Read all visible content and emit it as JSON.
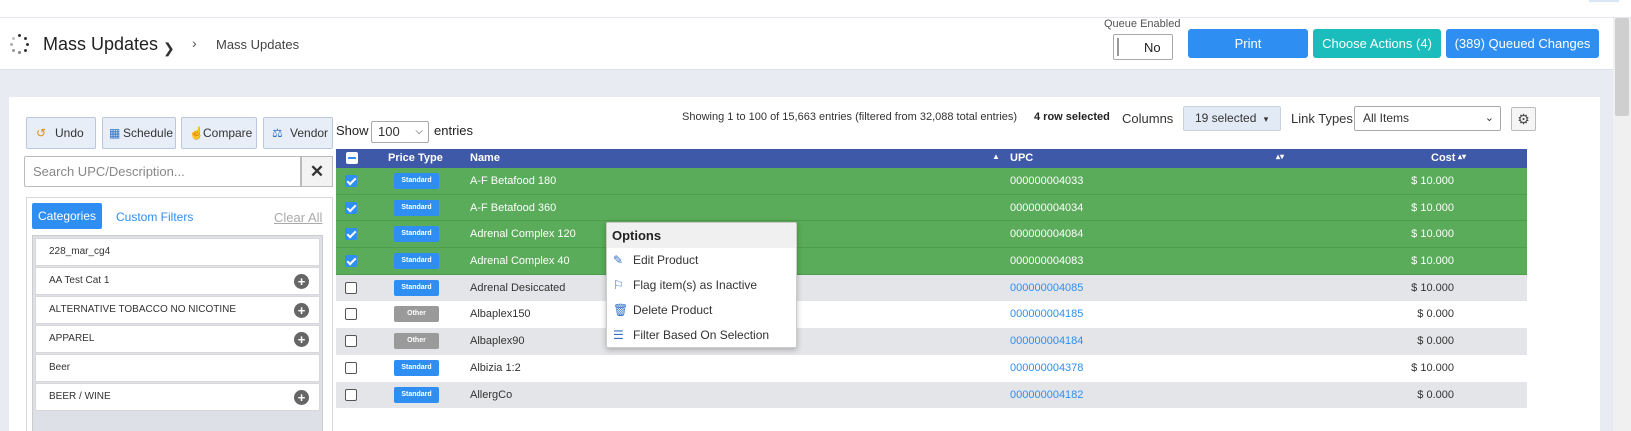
{
  "header": {
    "title": "Mass Updates",
    "breadcrumb": "Mass Updates",
    "queue_label": "Queue Enabled",
    "queue_value": "No",
    "print_label": "Print",
    "choose_actions_label": "Choose Actions (4)",
    "queued_changes_label": "(389) Queued Changes"
  },
  "left": {
    "undo_label": "Undo",
    "schedule_label": "Schedule",
    "compare_label": "Compare",
    "vendor_label": "Vendor",
    "search_placeholder": "Search UPC/Description...",
    "tab_categories": "Categories",
    "tab_custom_filters": "Custom Filters",
    "clear_all": "Clear All",
    "categories": [
      {
        "label": "228_mar_cg4",
        "has_plus": false
      },
      {
        "label": "AA Test Cat 1",
        "has_plus": true
      },
      {
        "label": "ALTERNATIVE TOBACCO NO NICOTINE",
        "has_plus": true
      },
      {
        "label": "APPAREL",
        "has_plus": true
      },
      {
        "label": "Beer",
        "has_plus": false
      },
      {
        "label": "BEER / WINE",
        "has_plus": true
      }
    ]
  },
  "table_controls": {
    "show_label": "Show",
    "page_size": "100",
    "entries_label": "entries",
    "showing_text": "Showing 1 to 100 of 15,663 entries (filtered from 32,088 total entries)",
    "row_selected_text": "4 row selected",
    "columns_label": "Columns",
    "columns_value": "19 selected",
    "link_types_label": "Link Types",
    "link_types_value": "All Items"
  },
  "table": {
    "headers": {
      "price_type": "Price Type",
      "name": "Name",
      "upc": "UPC",
      "cost": "Cost"
    },
    "rows": [
      {
        "selected": true,
        "price_type": "Standard",
        "name": "A-F Betafood 180",
        "upc": "000000004033",
        "cost": "$ 10.000"
      },
      {
        "selected": true,
        "price_type": "Standard",
        "name": "A-F Betafood 360",
        "upc": "000000004034",
        "cost": "$ 10.000"
      },
      {
        "selected": true,
        "price_type": "Standard",
        "name": "Adrenal Complex 120",
        "upc": "000000004084",
        "cost": "$ 10.000"
      },
      {
        "selected": true,
        "price_type": "Standard",
        "name": "Adrenal Complex 40",
        "upc": "000000004083",
        "cost": "$ 10.000"
      },
      {
        "selected": false,
        "price_type": "Standard",
        "name": "Adrenal Desiccated",
        "upc": "000000004085",
        "cost": "$ 10.000"
      },
      {
        "selected": false,
        "price_type": "Other",
        "name": "Albaplex150",
        "upc": "000000004185",
        "cost": "$ 0.000"
      },
      {
        "selected": false,
        "price_type": "Other",
        "name": "Albaplex90",
        "upc": "000000004184",
        "cost": "$ 0.000"
      },
      {
        "selected": false,
        "price_type": "Standard",
        "name": "Albizia 1:2",
        "upc": "000000004378",
        "cost": "$ 10.000"
      },
      {
        "selected": false,
        "price_type": "Standard",
        "name": "AllergCo",
        "upc": "000000004182",
        "cost": "$ 0.000"
      }
    ]
  },
  "context_menu": {
    "title": "Options",
    "items": [
      {
        "label": "Edit Product",
        "icon": "edit-icon"
      },
      {
        "label": "Flag item(s) as Inactive",
        "icon": "flag-icon"
      },
      {
        "label": "Delete Product",
        "icon": "trash-icon"
      },
      {
        "label": "Filter Based On Selection",
        "icon": "list-icon"
      }
    ]
  },
  "colors": {
    "primary": "#2f8ef2",
    "teal": "#1bbcbc",
    "table_header": "#3e59a8",
    "selected_row": "#5aab5a"
  }
}
